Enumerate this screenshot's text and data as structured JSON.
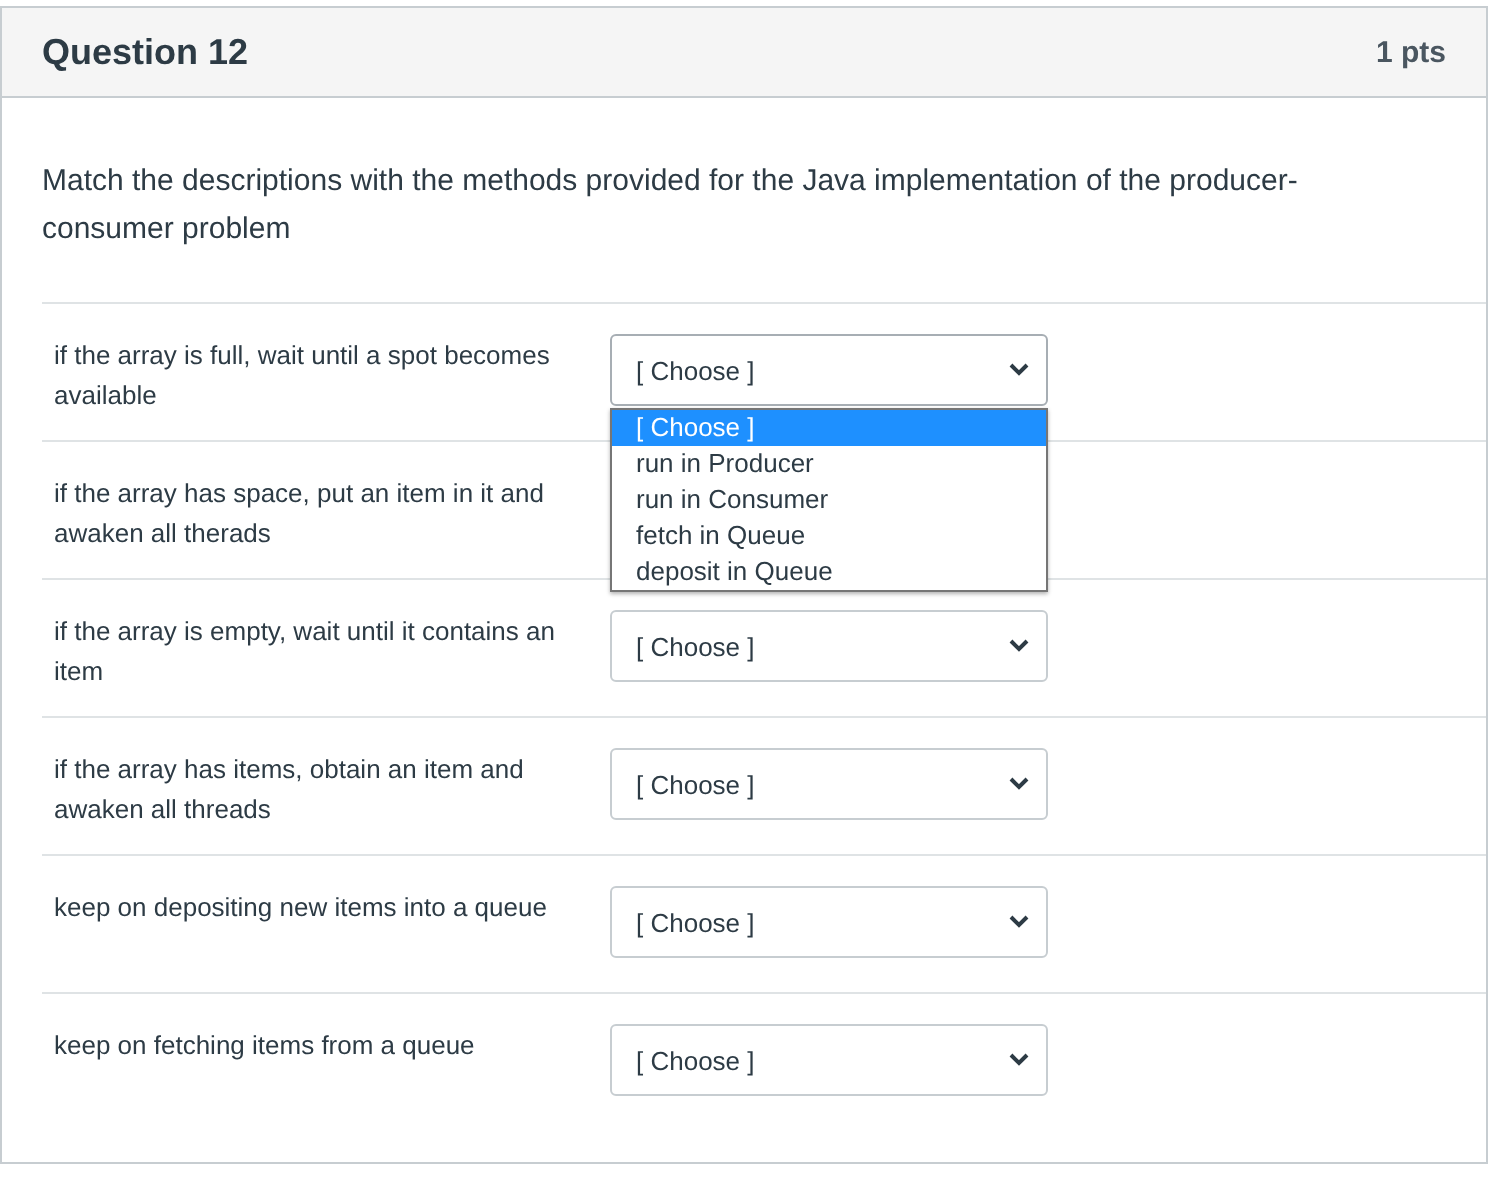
{
  "question": {
    "title": "Question 12",
    "points": "1 pts"
  },
  "prompt": "Match the descriptions with the methods provided for the Java implementation of the producer-consumer problem",
  "matches": [
    {
      "description": "if the array is full, wait until a spot becomes available",
      "select": {
        "value": "[ Choose ]",
        "open": true,
        "options": [
          {
            "label": "[ Choose ]",
            "selected": true
          },
          {
            "label": "run in Producer",
            "selected": false
          },
          {
            "label": "run in Consumer",
            "selected": false
          },
          {
            "label": "fetch in Queue",
            "selected": false
          },
          {
            "label": "deposit in Queue",
            "selected": false
          }
        ]
      }
    },
    {
      "description": "if the array has space, put an item in it and awaken all therads"
    },
    {
      "description": "if the array is empty, wait until it contains an item",
      "select": {
        "value": "[ Choose ]",
        "open": false
      }
    },
    {
      "description": "if the array has items, obtain an item and awaken all threads",
      "select": {
        "value": "[ Choose ]",
        "open": false
      }
    },
    {
      "description": "keep on depositing new items into a queue",
      "select": {
        "value": "[ Choose ]",
        "open": false
      }
    },
    {
      "description": "keep on fetching items from a queue",
      "select": {
        "value": "[ Choose ]",
        "open": false
      }
    }
  ]
}
